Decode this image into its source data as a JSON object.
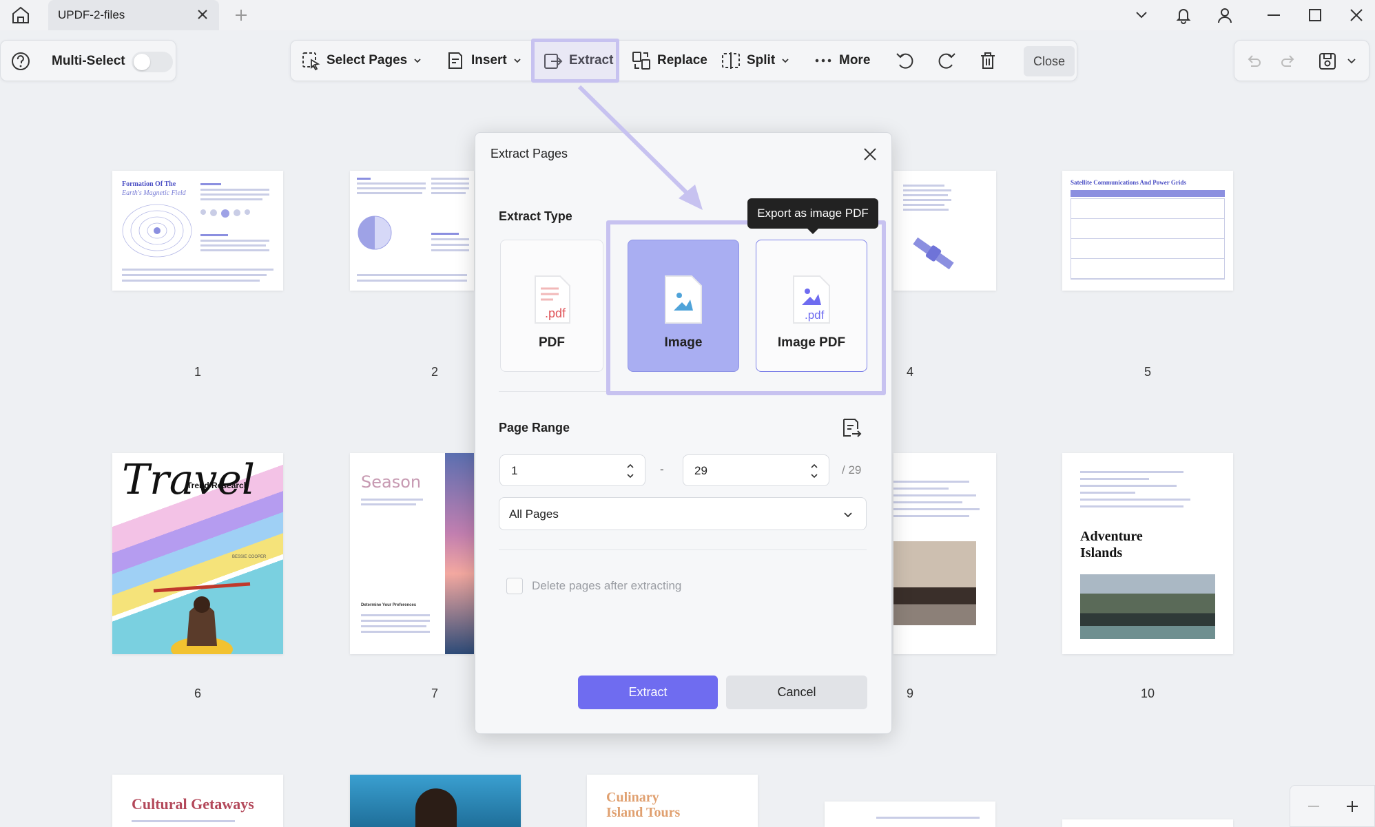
{
  "tab": {
    "title": "UPDF-2-files"
  },
  "toolbar_left": {
    "multi_select_label": "Multi-Select",
    "multi_select_on": false
  },
  "toolbar": {
    "select_pages": "Select Pages",
    "insert": "Insert",
    "extract": "Extract",
    "replace": "Replace",
    "split": "Split",
    "more": "More",
    "close": "Close"
  },
  "pages": [
    {
      "number": "1",
      "title_line1": "Formation Of The",
      "title_line2": "Earth's Magnetic Field"
    },
    {
      "number": "2"
    },
    {
      "number": "4"
    },
    {
      "number": "5",
      "title": "Satellite Communications And Power Grids"
    },
    {
      "number": "6",
      "title": "Travel",
      "subtitle": "Trend Research",
      "author": "BESSIE COOPER"
    },
    {
      "number": "7",
      "title": "Season",
      "section": "Determine Your Preferences"
    },
    {
      "number": "9"
    },
    {
      "number": "10",
      "title_line1": "Adventure",
      "title_line2": "Islands"
    },
    {
      "title": "Cultural Getaways"
    },
    {
      "title_line1": "Culinary",
      "title_line2": "Island Tours"
    }
  ],
  "dialog": {
    "title": "Extract Pages",
    "extract_type_label": "Extract Type",
    "types": [
      {
        "label": "PDF",
        "selected": false
      },
      {
        "label": "Image",
        "selected": true
      },
      {
        "label": "Image PDF",
        "selected": false
      }
    ],
    "file_ext": ".pdf",
    "tooltip": "Export as image PDF",
    "page_range_label": "Page Range",
    "range_from": "1",
    "range_sep": "-",
    "range_to": "29",
    "range_total": "/ 29",
    "range_select": "All Pages",
    "delete_label": "Delete pages after extracting",
    "extract_button": "Extract",
    "cancel_button": "Cancel"
  },
  "colors": {
    "accent": "#6f6cf0",
    "highlight": "#c7c2f0",
    "selected_card": "#a9aef2"
  }
}
